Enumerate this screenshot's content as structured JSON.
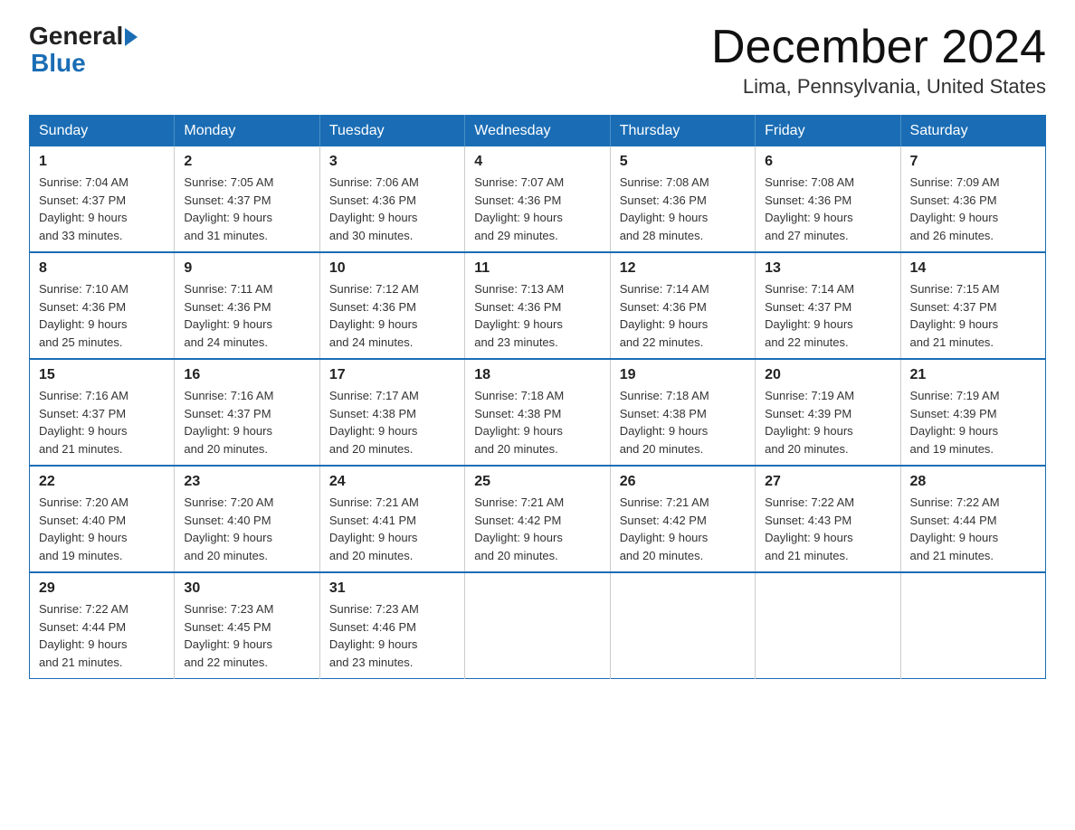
{
  "header": {
    "logo_general": "General",
    "logo_blue": "Blue",
    "month_title": "December 2024",
    "location": "Lima, Pennsylvania, United States"
  },
  "calendar": {
    "days_of_week": [
      "Sunday",
      "Monday",
      "Tuesday",
      "Wednesday",
      "Thursday",
      "Friday",
      "Saturday"
    ],
    "weeks": [
      [
        {
          "day": "1",
          "sunrise": "7:04 AM",
          "sunset": "4:37 PM",
          "daylight": "9 hours and 33 minutes."
        },
        {
          "day": "2",
          "sunrise": "7:05 AM",
          "sunset": "4:37 PM",
          "daylight": "9 hours and 31 minutes."
        },
        {
          "day": "3",
          "sunrise": "7:06 AM",
          "sunset": "4:36 PM",
          "daylight": "9 hours and 30 minutes."
        },
        {
          "day": "4",
          "sunrise": "7:07 AM",
          "sunset": "4:36 PM",
          "daylight": "9 hours and 29 minutes."
        },
        {
          "day": "5",
          "sunrise": "7:08 AM",
          "sunset": "4:36 PM",
          "daylight": "9 hours and 28 minutes."
        },
        {
          "day": "6",
          "sunrise": "7:08 AM",
          "sunset": "4:36 PM",
          "daylight": "9 hours and 27 minutes."
        },
        {
          "day": "7",
          "sunrise": "7:09 AM",
          "sunset": "4:36 PM",
          "daylight": "9 hours and 26 minutes."
        }
      ],
      [
        {
          "day": "8",
          "sunrise": "7:10 AM",
          "sunset": "4:36 PM",
          "daylight": "9 hours and 25 minutes."
        },
        {
          "day": "9",
          "sunrise": "7:11 AM",
          "sunset": "4:36 PM",
          "daylight": "9 hours and 24 minutes."
        },
        {
          "day": "10",
          "sunrise": "7:12 AM",
          "sunset": "4:36 PM",
          "daylight": "9 hours and 24 minutes."
        },
        {
          "day": "11",
          "sunrise": "7:13 AM",
          "sunset": "4:36 PM",
          "daylight": "9 hours and 23 minutes."
        },
        {
          "day": "12",
          "sunrise": "7:14 AM",
          "sunset": "4:36 PM",
          "daylight": "9 hours and 22 minutes."
        },
        {
          "day": "13",
          "sunrise": "7:14 AM",
          "sunset": "4:37 PM",
          "daylight": "9 hours and 22 minutes."
        },
        {
          "day": "14",
          "sunrise": "7:15 AM",
          "sunset": "4:37 PM",
          "daylight": "9 hours and 21 minutes."
        }
      ],
      [
        {
          "day": "15",
          "sunrise": "7:16 AM",
          "sunset": "4:37 PM",
          "daylight": "9 hours and 21 minutes."
        },
        {
          "day": "16",
          "sunrise": "7:16 AM",
          "sunset": "4:37 PM",
          "daylight": "9 hours and 20 minutes."
        },
        {
          "day": "17",
          "sunrise": "7:17 AM",
          "sunset": "4:38 PM",
          "daylight": "9 hours and 20 minutes."
        },
        {
          "day": "18",
          "sunrise": "7:18 AM",
          "sunset": "4:38 PM",
          "daylight": "9 hours and 20 minutes."
        },
        {
          "day": "19",
          "sunrise": "7:18 AM",
          "sunset": "4:38 PM",
          "daylight": "9 hours and 20 minutes."
        },
        {
          "day": "20",
          "sunrise": "7:19 AM",
          "sunset": "4:39 PM",
          "daylight": "9 hours and 20 minutes."
        },
        {
          "day": "21",
          "sunrise": "7:19 AM",
          "sunset": "4:39 PM",
          "daylight": "9 hours and 19 minutes."
        }
      ],
      [
        {
          "day": "22",
          "sunrise": "7:20 AM",
          "sunset": "4:40 PM",
          "daylight": "9 hours and 19 minutes."
        },
        {
          "day": "23",
          "sunrise": "7:20 AM",
          "sunset": "4:40 PM",
          "daylight": "9 hours and 20 minutes."
        },
        {
          "day": "24",
          "sunrise": "7:21 AM",
          "sunset": "4:41 PM",
          "daylight": "9 hours and 20 minutes."
        },
        {
          "day": "25",
          "sunrise": "7:21 AM",
          "sunset": "4:42 PM",
          "daylight": "9 hours and 20 minutes."
        },
        {
          "day": "26",
          "sunrise": "7:21 AM",
          "sunset": "4:42 PM",
          "daylight": "9 hours and 20 minutes."
        },
        {
          "day": "27",
          "sunrise": "7:22 AM",
          "sunset": "4:43 PM",
          "daylight": "9 hours and 21 minutes."
        },
        {
          "day": "28",
          "sunrise": "7:22 AM",
          "sunset": "4:44 PM",
          "daylight": "9 hours and 21 minutes."
        }
      ],
      [
        {
          "day": "29",
          "sunrise": "7:22 AM",
          "sunset": "4:44 PM",
          "daylight": "9 hours and 21 minutes."
        },
        {
          "day": "30",
          "sunrise": "7:23 AM",
          "sunset": "4:45 PM",
          "daylight": "9 hours and 22 minutes."
        },
        {
          "day": "31",
          "sunrise": "7:23 AM",
          "sunset": "4:46 PM",
          "daylight": "9 hours and 23 minutes."
        },
        null,
        null,
        null,
        null
      ]
    ]
  }
}
